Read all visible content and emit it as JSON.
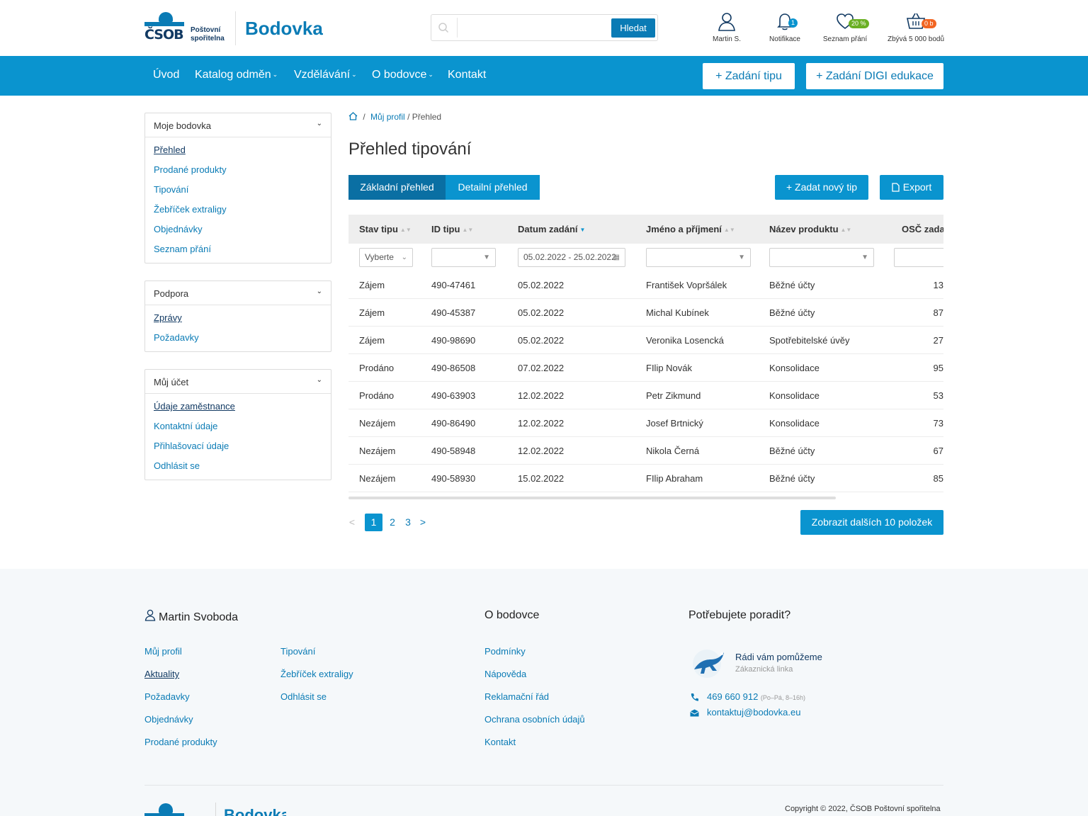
{
  "brand": {
    "logo_word": "ČSOB",
    "logo_sub_1": "Poštovní",
    "logo_sub_2": "spořitelna",
    "name": "Bodovka"
  },
  "search": {
    "placeholder": "",
    "button": "Hledat"
  },
  "header_icons": [
    {
      "label": "Martin S.",
      "icon": "user-icon"
    },
    {
      "label": "Notifikace",
      "icon": "bell-icon",
      "badge": "1"
    },
    {
      "label": "Seznam přání",
      "icon": "heart-icon",
      "badge": "20 %"
    },
    {
      "label": "Zbývá 5 000 bodů",
      "icon": "basket-icon",
      "badge": "0 b"
    }
  ],
  "nav": {
    "items": [
      "Úvod",
      "Katalog odměn",
      "Vzdělávání",
      "O bodovce",
      "Kontakt"
    ],
    "btn_tip": "+ Zadání tipu",
    "btn_digi": "+ Zadání DIGI edukace"
  },
  "sidebar": {
    "sections": [
      {
        "title": "Moje bodovka",
        "items": [
          "Přehled",
          "Prodané produkty",
          "Tipování",
          "Žebříček extraligy",
          "Objednávky",
          "Seznam přání"
        ]
      },
      {
        "title": "Podpora",
        "items": [
          "Zprávy",
          "Požadavky"
        ]
      },
      {
        "title": "Můj účet",
        "items": [
          "Údaje zaměstnance",
          "Kontaktní údaje",
          "Přihlašovací údaje",
          "Odhlásit se"
        ]
      }
    ]
  },
  "breadcrumb": {
    "sep": "/",
    "profile": "Můj profil",
    "current": "/ Přehled"
  },
  "main": {
    "title": "Přehled tipování",
    "tab_basic": "Základní přehled",
    "tab_detail": "Detailní přehled",
    "btn_new": "+ Zadat nový tip",
    "btn_export": "Export"
  },
  "table": {
    "columns": [
      "Stav tipu",
      "ID tipu",
      "Datum zadání",
      "Jméno a příjmení",
      "Název produktu",
      "OSČ zada"
    ],
    "filters": {
      "status": "Vyberte",
      "date": "05.02.2022 - 25.02.2022"
    },
    "rows": [
      [
        "Zájem",
        "490-47461",
        "05.02.2022",
        "František Vopršálek",
        "Běžné účty",
        "13"
      ],
      [
        "Zájem",
        "490-45387",
        "05.02.2022",
        "Michal Kubínek",
        "Běžné účty",
        "87"
      ],
      [
        "Zájem",
        "490-98690",
        "05.02.2022",
        "Veronika Losencká",
        "Spotřebitelské úvěy",
        "27"
      ],
      [
        "Prodáno",
        "490-86508",
        "07.02.2022",
        "FIlip Novák",
        "Konsolidace",
        "95"
      ],
      [
        "Prodáno",
        "490-63903",
        "12.02.2022",
        "Petr Zikmund",
        "Konsolidace",
        "53"
      ],
      [
        "Nezájem",
        "490-86490",
        "12.02.2022",
        "Josef Brtnický",
        "Konsolidace",
        "73"
      ],
      [
        "Nezájem",
        "490-58948",
        "12.02.2022",
        "Nikola Černá",
        "Běžné účty",
        "67"
      ],
      [
        "Nezájem",
        "490-58930",
        "15.02.2022",
        "FIlip Abraham",
        "Běžné účty",
        "85"
      ]
    ]
  },
  "pagination": {
    "prev": "<",
    "pages": [
      "1",
      "2",
      "3"
    ],
    "next": ">",
    "more": "Zobrazit dalších 10 položek"
  },
  "footer": {
    "user_name": "Martin Svoboda",
    "user_links_col1": [
      "Můj profil",
      "Aktuality",
      "Požadavky",
      "Objednávky",
      "Prodané produkty"
    ],
    "user_links_col2": [
      "Tipování",
      "Žebříček extraligy",
      "Odhlásit se"
    ],
    "about_title": "O bodovce",
    "about_links": [
      "Podmínky",
      "Nápověda",
      "Reklamační řád",
      "Ochrana osobních údajů",
      "Kontakt"
    ],
    "help_title": "Potřebujete poradit?",
    "help_head": "Rádi vám pomůžeme",
    "help_sub": "Zákaznická linka",
    "phone": "469 660 912",
    "phone_hours": "(Po–Pá, 8–16h)",
    "email": "kontaktuj@bodovka.eu",
    "copyright": "Copyright © 2022, ČSOB Poštovní spořitelna",
    "logo_word": "ČSOB",
    "brand": "Bodovka"
  },
  "colors": {
    "primary": "#0a94cf",
    "link": "#0a7bb5",
    "dark": "#123a63",
    "badge_green": "#6ab023",
    "badge_orange": "#f26522"
  }
}
